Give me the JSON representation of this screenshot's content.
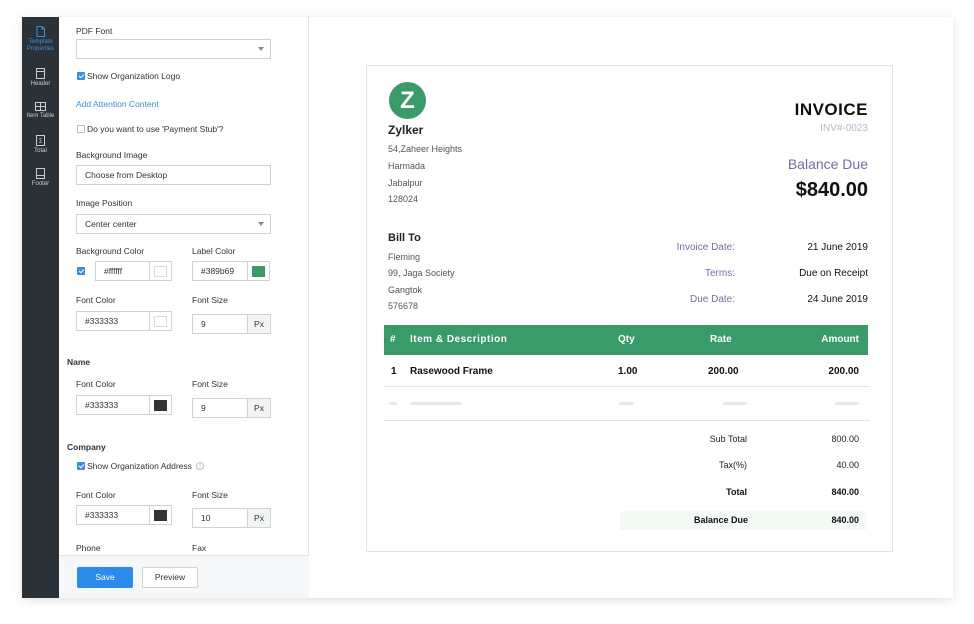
{
  "rail": {
    "items": [
      {
        "label_line1": "Template",
        "label_line2": "Properties"
      },
      {
        "label_line1": "Header",
        "label_line2": ""
      },
      {
        "label_line1": "Item Table",
        "label_line2": ""
      },
      {
        "label_line1": "Total",
        "label_line2": ""
      },
      {
        "label_line1": "Footer",
        "label_line2": ""
      }
    ]
  },
  "panel": {
    "pdf_font_label": "PDF Font",
    "pdf_font_value": "",
    "show_org_logo_label": "Show Organization Logo",
    "show_org_logo_checked": true,
    "add_attention_link": "Add Attention Content",
    "payment_stub_label": "Do you want to use 'Payment Stub'?",
    "payment_stub_checked": false,
    "background_image_label": "Background Image",
    "choose_from_desktop": "Choose from Desktop",
    "image_position_label": "Image Position",
    "image_position_value": "Center center",
    "background_color_label": "Background Color",
    "background_color_value": "#ffffff",
    "background_color_checked": true,
    "label_color_label": "Label Color",
    "label_color_value": "#389b69",
    "font_color_label": "Font Color",
    "font_color_value": "#333333",
    "font_size_label": "Font Size",
    "font_size_value": "9",
    "px_unit": "Px",
    "name_section": "Name",
    "name_font_color_label": "Font Color",
    "name_font_color_value": "#333333",
    "name_font_size_label": "Font Size",
    "name_font_size_value": "9",
    "company_section": "Company",
    "show_org_address_label": "Show Organization Address",
    "show_org_address_checked": true,
    "company_font_color_label": "Font Color",
    "company_font_color_value": "#333333",
    "company_font_size_label": "Font Size",
    "company_font_size_value": "10",
    "phone_label": "Phone",
    "fax_label": "Fax",
    "save_label": "Save",
    "preview_label": "Preview"
  },
  "invoice": {
    "logo_letter": "Z",
    "company_name": "Zylker",
    "address_lines": [
      "54,Zaheer Heights",
      "Harmada",
      "Jabalpur",
      "128024"
    ],
    "title": "INVOICE",
    "number": "INV#-0023",
    "balance_due_label": "Balance Due",
    "balance_due_amount": "$840.00",
    "bill_to_label": "Bill To",
    "bill_to_lines": [
      "Fleming",
      "99, Jaga Society",
      "Gangtok",
      "576678"
    ],
    "invoice_date_label": "Invoice Date:",
    "invoice_date_value": "21 June 2019",
    "terms_label": "Terms:",
    "terms_value": "Due on Receipt",
    "due_date_label": "Due Date:",
    "due_date_value": "24 June 2019",
    "table_headers": [
      "#",
      "Item & Description",
      "Qty",
      "Rate",
      "Amount"
    ],
    "rows": [
      {
        "num": "1",
        "item": "Rasewood Frame",
        "qty": "1.00",
        "rate": "200.00",
        "amount": "200.00"
      }
    ],
    "sub_total_label": "Sub Total",
    "sub_total_value": "800.00",
    "tax_label": "Tax(%)",
    "tax_value": "40.00",
    "total_label": "Total",
    "total_value": "840.00",
    "balance_due_row_label": "Balance Due",
    "balance_due_row_value": "840.00"
  },
  "colors": {
    "accent": "#2c8be8",
    "brand_green": "#389b69",
    "rail_bg": "#2b3237",
    "muted_label": "#6f6fa8"
  }
}
